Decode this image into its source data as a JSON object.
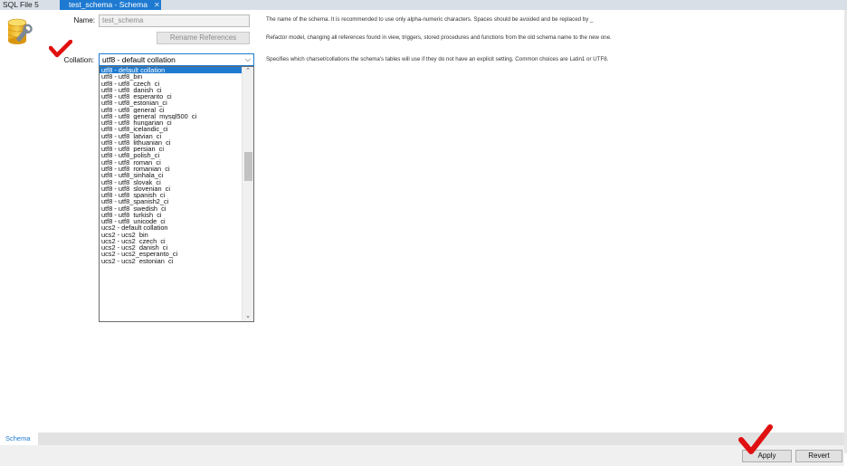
{
  "tabs": [
    {
      "label": "SQL File 5",
      "active": false
    },
    {
      "label": "test_schema - Schema",
      "active": true
    }
  ],
  "form": {
    "name_label": "Name:",
    "name_value": "test_schema",
    "rename_button": "Rename References",
    "collation_label": "Collation:",
    "collation_selected": "utf8 - default collation"
  },
  "descriptions": {
    "name": "The name of the schema. It is recommended to use only alpha-numeric characters. Spaces should be avoided and be replaced by _",
    "rename": "Refactor model, changing all references found in view, triggers, stored procedures and functions from the old schema name to the new one.",
    "collation": "Specifies which charset/collations the schema's tables will use if they do not have an explicit setting. Common choices are Latin1 or UTF8."
  },
  "collation_options": [
    "utf8 - default collation",
    "utf8 - utf8_bin",
    "utf8 - utf8_czech_ci",
    "utf8 - utf8_danish_ci",
    "utf8 - utf8_esperanto_ci",
    "utf8 - utf8_estonian_ci",
    "utf8 - utf8_general_ci",
    "utf8 - utf8_general_mysql500_ci",
    "utf8 - utf8_hungarian_ci",
    "utf8 - utf8_icelandic_ci",
    "utf8 - utf8_latvian_ci",
    "utf8 - utf8_lithuanian_ci",
    "utf8 - utf8_persian_ci",
    "utf8 - utf8_polish_ci",
    "utf8 - utf8_roman_ci",
    "utf8 - utf8_romanian_ci",
    "utf8 - utf8_sinhala_ci",
    "utf8 - utf8_slovak_ci",
    "utf8 - utf8_slovenian_ci",
    "utf8 - utf8_spanish_ci",
    "utf8 - utf8_spanish2_ci",
    "utf8 - utf8_swedish_ci",
    "utf8 - utf8_turkish_ci",
    "utf8 - utf8_unicode_ci",
    "ucs2 - default collation",
    "ucs2 - ucs2_bin",
    "ucs2 - ucs2_czech_ci",
    "ucs2 - ucs2_danish_ci",
    "ucs2 - ucs2_esperanto_ci",
    "ucs2 - ucs2_estonian_ci"
  ],
  "bottom": {
    "schema_tab": "Schema",
    "apply_button": "Apply",
    "revert_button": "Revert"
  },
  "icons": {
    "tab_close": "close-icon",
    "schema": "database-schema-icon",
    "dropdown": "chevron-down-icon",
    "scroll_up": "chevron-up-icon",
    "scroll_down": "chevron-down-icon",
    "annotation_check": "red-check-mark-icon"
  },
  "colors": {
    "accent": "#1e7ad1",
    "check_mark": "#e01010"
  }
}
